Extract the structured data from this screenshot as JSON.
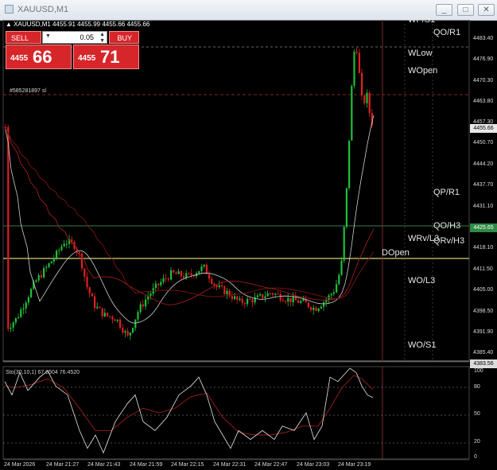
{
  "window": {
    "title": "XAUUSD,M1",
    "buttons": [
      "_",
      "□",
      "✕"
    ]
  },
  "symbol_header": "XAUUSD,M1 4455.91 4455.99 4455.66 4455.66",
  "trade_panel": {
    "sell_label": "SELL",
    "buy_label": "BUY",
    "lot": "0.05",
    "sell_big": "4455",
    "sell_pips": "66",
    "buy_big": "4455",
    "buy_pips": "71"
  },
  "order_label": "#585281897 sl",
  "level_labels": {
    "wp_s1": "WP/S1",
    "qo_r1": "QO/R1",
    "wlow": "WLow",
    "wopen": "WOpen",
    "qp_r1": "QP/R1",
    "qo_h3": "QO/H3",
    "wrv_l3": "WRv/L3",
    "qrv_h3": "QRv/H3",
    "dopen": "DOpen",
    "wo_l3": "WO/L3",
    "wo_s1": "WO/S1"
  },
  "price_axis": [
    "4483.40",
    "4476.90",
    "4470.30",
    "4463.80",
    "4457.30",
    "4450.70",
    "4444.20",
    "4437.70",
    "4431.10",
    "4418.10",
    "4411.50",
    "4405.00",
    "4398.50",
    "4391.90",
    "4385.40"
  ],
  "price_badges": {
    "current": "4455.66",
    "level_green": "4425.65",
    "low": "4383.56"
  },
  "stochastic": {
    "header": "Sto(30,10,1) 67.0504 76.4520",
    "levels": [
      "100",
      "80",
      "50",
      "20",
      "0"
    ]
  },
  "time_axis": [
    "24 Mar 2026",
    "24 Mar 21:27",
    "24 Mar 21:43",
    "24 Mar 21:59",
    "24 Mar 22:15",
    "24 Mar 22:31",
    "24 Mar 22:47",
    "24 Mar 23:03",
    "24 Mar 23:19"
  ],
  "colors": {
    "bull": "#1fbf3a",
    "bear": "#e02020",
    "level_green": "#3a7d4a",
    "level_yellow": "#d8d07a",
    "grid": "#2a2a2a",
    "ma_white": "#cfcfcf",
    "ma_red": "#9c1e1e"
  }
}
